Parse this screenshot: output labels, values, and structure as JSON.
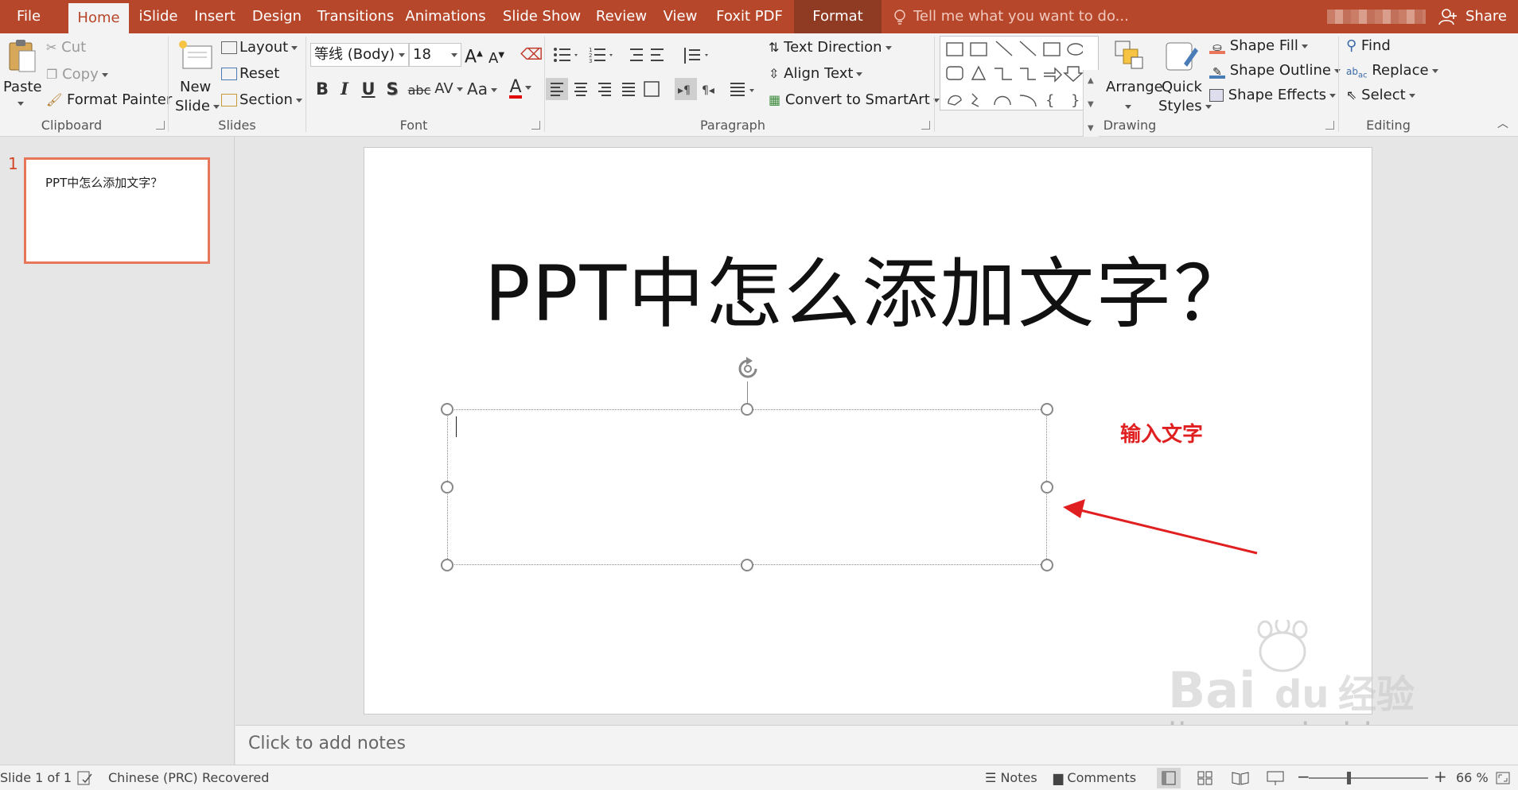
{
  "tabs": {
    "file": "File",
    "home": "Home",
    "islide": "iSlide",
    "insert": "Insert",
    "design": "Design",
    "transitions": "Transitions",
    "animations": "Animations",
    "slideshow": "Slide Show",
    "review": "Review",
    "view": "View",
    "foxit": "Foxit PDF",
    "format": "Format"
  },
  "tell_me": "Tell me what you want to do...",
  "share": "Share",
  "accent_color": "#b7472a",
  "clipboard": {
    "paste": "Paste",
    "cut": "Cut",
    "copy": "Copy",
    "format_painter": "Format Painter",
    "label": "Clipboard"
  },
  "slides": {
    "new_slide_1": "New",
    "new_slide_2": "Slide",
    "layout": "Layout",
    "reset": "Reset",
    "section": "Section",
    "label": "Slides"
  },
  "font": {
    "face": "等线 (Body)",
    "size": "18",
    "grow": "A",
    "shrink": "A",
    "bold": "B",
    "italic": "I",
    "underline": "U",
    "shadow": "S",
    "strike": "abc",
    "spacing": "AV",
    "case": "Aa",
    "color_a": "A",
    "label": "Font"
  },
  "paragraph": {
    "text_direction": "Text Direction",
    "align_text": "Align Text",
    "smartart": "Convert to SmartArt",
    "label": "Paragraph"
  },
  "drawing": {
    "arrange": "Arrange",
    "quick_styles_1": "Quick",
    "quick_styles_2": "Styles",
    "shape_fill": "Shape Fill",
    "shape_outline": "Shape Outline",
    "shape_effects": "Shape Effects",
    "label": "Drawing"
  },
  "editing": {
    "find": "Find",
    "replace": "Replace",
    "select": "Select",
    "label": "Editing"
  },
  "thumbnail": {
    "number": "1",
    "title": "PPT中怎么添加文字？"
  },
  "slide": {
    "title": "PPT中怎么添加文字？"
  },
  "annotation": {
    "text": "输入文字",
    "color": "#e02020"
  },
  "watermark": {
    "logo": "Bai du 经验",
    "domain": "jingyan.baidu.com"
  },
  "notes": {
    "placeholder": "Click to add notes"
  },
  "status": {
    "slide_of": "Slide 1 of 1",
    "language": "Chinese (PRC)",
    "recovered": "Recovered",
    "notes": "Notes",
    "comments": "Comments",
    "zoom": "66 %"
  }
}
